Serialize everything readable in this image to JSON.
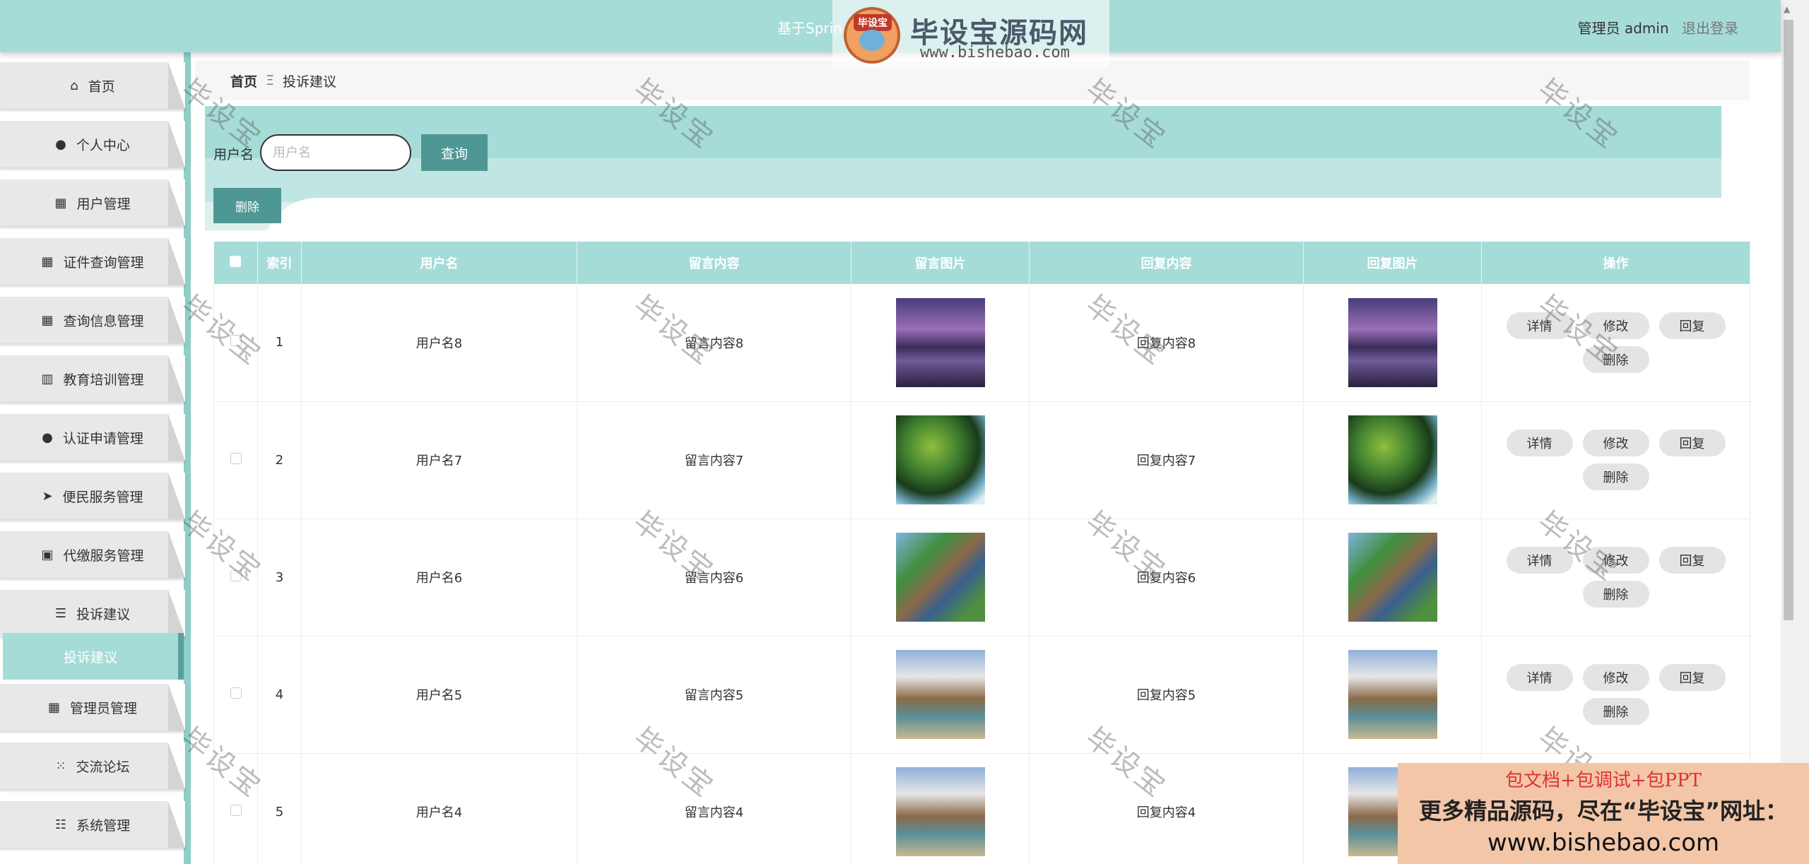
{
  "header": {
    "title": "基于Sprin",
    "user_label": "管理员 admin",
    "logout": "退出登录"
  },
  "logo_watermark": {
    "badge": "毕设宝",
    "name": "毕设宝源码网",
    "url": "www.bishebao.com"
  },
  "sidebar": {
    "items": [
      {
        "label": "首页",
        "icon": "home-icon"
      },
      {
        "label": "个人中心",
        "icon": "person-icon"
      },
      {
        "label": "用户管理",
        "icon": "grid-icon"
      },
      {
        "label": "证件查询管理",
        "icon": "grid-icon"
      },
      {
        "label": "查询信息管理",
        "icon": "grid-icon"
      },
      {
        "label": "教育培训管理",
        "icon": "book-icon"
      },
      {
        "label": "认证申请管理",
        "icon": "bulb-icon"
      },
      {
        "label": "便民服务管理",
        "icon": "send-icon"
      },
      {
        "label": "代缴服务管理",
        "icon": "clipboard-icon"
      },
      {
        "label": "投诉建议",
        "icon": "list-icon"
      },
      {
        "label": "管理员管理",
        "icon": "grid-icon"
      },
      {
        "label": "交流论坛",
        "icon": "apps-icon"
      },
      {
        "label": "系统管理",
        "icon": "sliders-icon"
      }
    ],
    "active_submenu": "投诉建议"
  },
  "breadcrumb": {
    "home": "首页",
    "separator": "Ξ",
    "current": "投诉建议"
  },
  "search": {
    "label": "用户名",
    "placeholder": "用户名",
    "value": "",
    "query_button": "查询",
    "delete_button": "删除"
  },
  "table": {
    "columns": [
      "",
      "索引",
      "用户名",
      "留言内容",
      "留言图片",
      "回复内容",
      "回复图片",
      "操作"
    ],
    "rows": [
      {
        "index": "1",
        "username": "用户名8",
        "message": "留言内容8",
        "reply": "回复内容8",
        "image": "mountain-lake-image"
      },
      {
        "index": "2",
        "username": "用户名7",
        "message": "留言内容7",
        "reply": "回复内容7",
        "image": "forest-waterfall-image"
      },
      {
        "index": "3",
        "username": "用户名6",
        "message": "留言内容6",
        "reply": "回复内容6",
        "image": "river-valley-image"
      },
      {
        "index": "4",
        "username": "用户名5",
        "message": "留言内容5",
        "reply": "回复内容5",
        "image": "sea-arch-image"
      },
      {
        "index": "5",
        "username": "用户名4",
        "message": "留言内容4",
        "reply": "回复内容4",
        "image": "sea-arch-image"
      }
    ],
    "actions": {
      "detail": "详情",
      "edit": "修改",
      "reply": "回复",
      "delete": "删除"
    }
  },
  "watermark_text": "毕设宝",
  "ad_banner": {
    "line1": "包文档+包调试+包PPT",
    "line2": "更多精品源码，尽在“毕设宝”网址：",
    "line3": "www.bishebao.com"
  }
}
